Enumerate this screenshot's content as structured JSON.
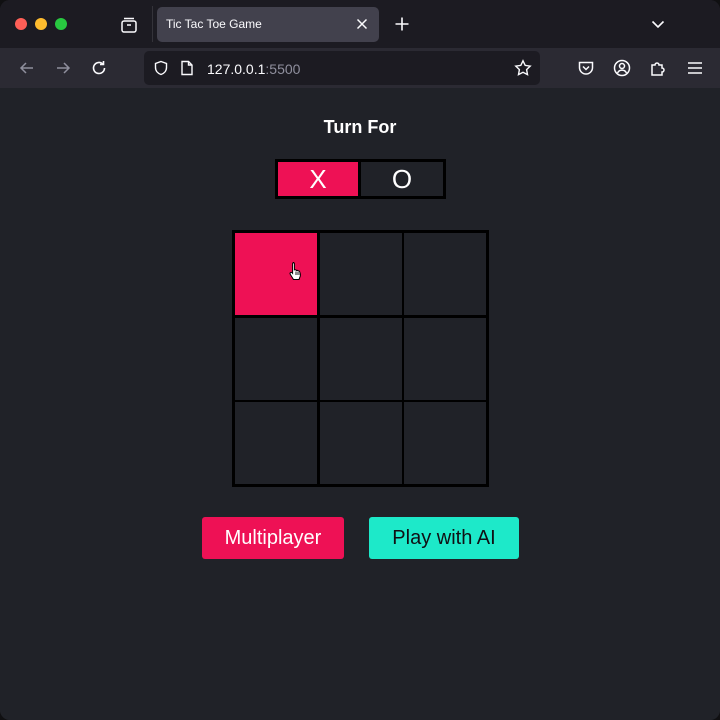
{
  "browser": {
    "tab_title": "Tic Tac Toe Game",
    "url_host": "127.0.0.1",
    "url_port": ":5500"
  },
  "game": {
    "turn_title": "Turn For",
    "turn_options": [
      "X",
      "O"
    ],
    "active_turn": "X",
    "cells": [
      "",
      "",
      "",
      "",
      "",
      "",
      "",
      "",
      ""
    ],
    "hovered_cell": 1,
    "buttons": {
      "multiplayer": "Multiplayer",
      "play_ai": "Play with AI"
    }
  },
  "colors": {
    "accent_pink": "#ee1155",
    "accent_teal": "#1de9c9",
    "background": "#202228",
    "grid_line": "#000000"
  },
  "icons": [
    "tab-list-icon",
    "close-icon",
    "plus-icon",
    "chevron-down-icon",
    "back-icon",
    "forward-icon",
    "reload-icon",
    "shield-icon",
    "page-icon",
    "star-icon",
    "pocket-icon",
    "account-icon",
    "extensions-icon",
    "menu-icon",
    "pointer-cursor-icon"
  ]
}
